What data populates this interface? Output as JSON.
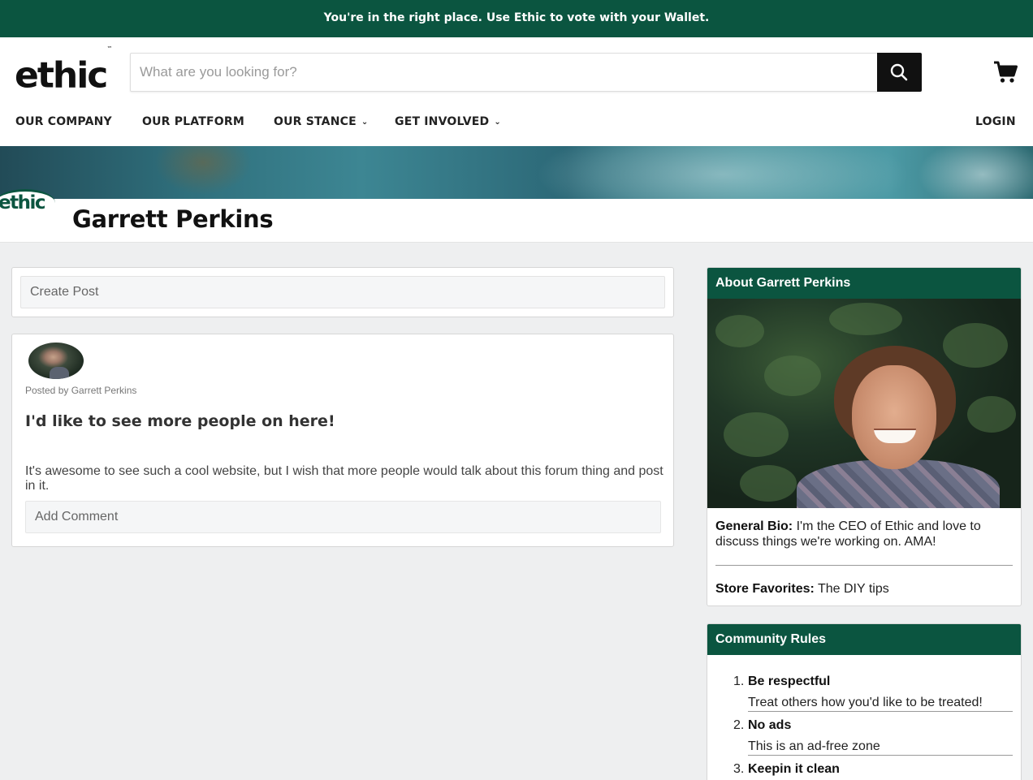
{
  "announcement": "You're in the right place. Use Ethic to vote with your Wallet.",
  "header": {
    "logo": "ethic",
    "logo_tm": "™",
    "search_placeholder": "What are you looking for?",
    "icons": {
      "search": "search-icon",
      "cart": "cart-icon"
    }
  },
  "nav": {
    "items": [
      {
        "label": "OUR COMPANY"
      },
      {
        "label": "OUR PLATFORM"
      },
      {
        "label": "OUR STANCE",
        "dropdown": true
      },
      {
        "label": "GET INVOLVED",
        "dropdown": true
      }
    ],
    "login": "LOGIN"
  },
  "profile": {
    "badge_text": "ethic",
    "name": "Garrett Perkins"
  },
  "feed": {
    "create_post": "Create Post",
    "posts": [
      {
        "posted_by": "Posted by Garrett Perkins",
        "title": "I'd like to see more people on here!",
        "body": "It's awesome to see such a cool website, but I wish that more people would talk about this forum thing and post in it.",
        "comment_placeholder": "Add Comment"
      }
    ]
  },
  "about": {
    "heading": "About Garrett Perkins",
    "bio_label": "General Bio:",
    "bio_text": "I'm the CEO of Ethic and love to discuss things we're working on. AMA!",
    "favorites_label": "Store Favorites:",
    "favorites_text": "The DIY tips"
  },
  "rules": {
    "heading": "Community Rules",
    "items": [
      {
        "num": "1.",
        "title": "Be respectful",
        "desc": "Treat others how you'd like to be treated!"
      },
      {
        "num": "2.",
        "title": "No ads",
        "desc": "This is an ad-free zone"
      },
      {
        "num": "3.",
        "title": "Keepin it clean",
        "desc": ""
      }
    ]
  },
  "colors": {
    "brand_green": "#0b5540",
    "page_bg": "#eeeff0",
    "search_button": "#111111"
  }
}
